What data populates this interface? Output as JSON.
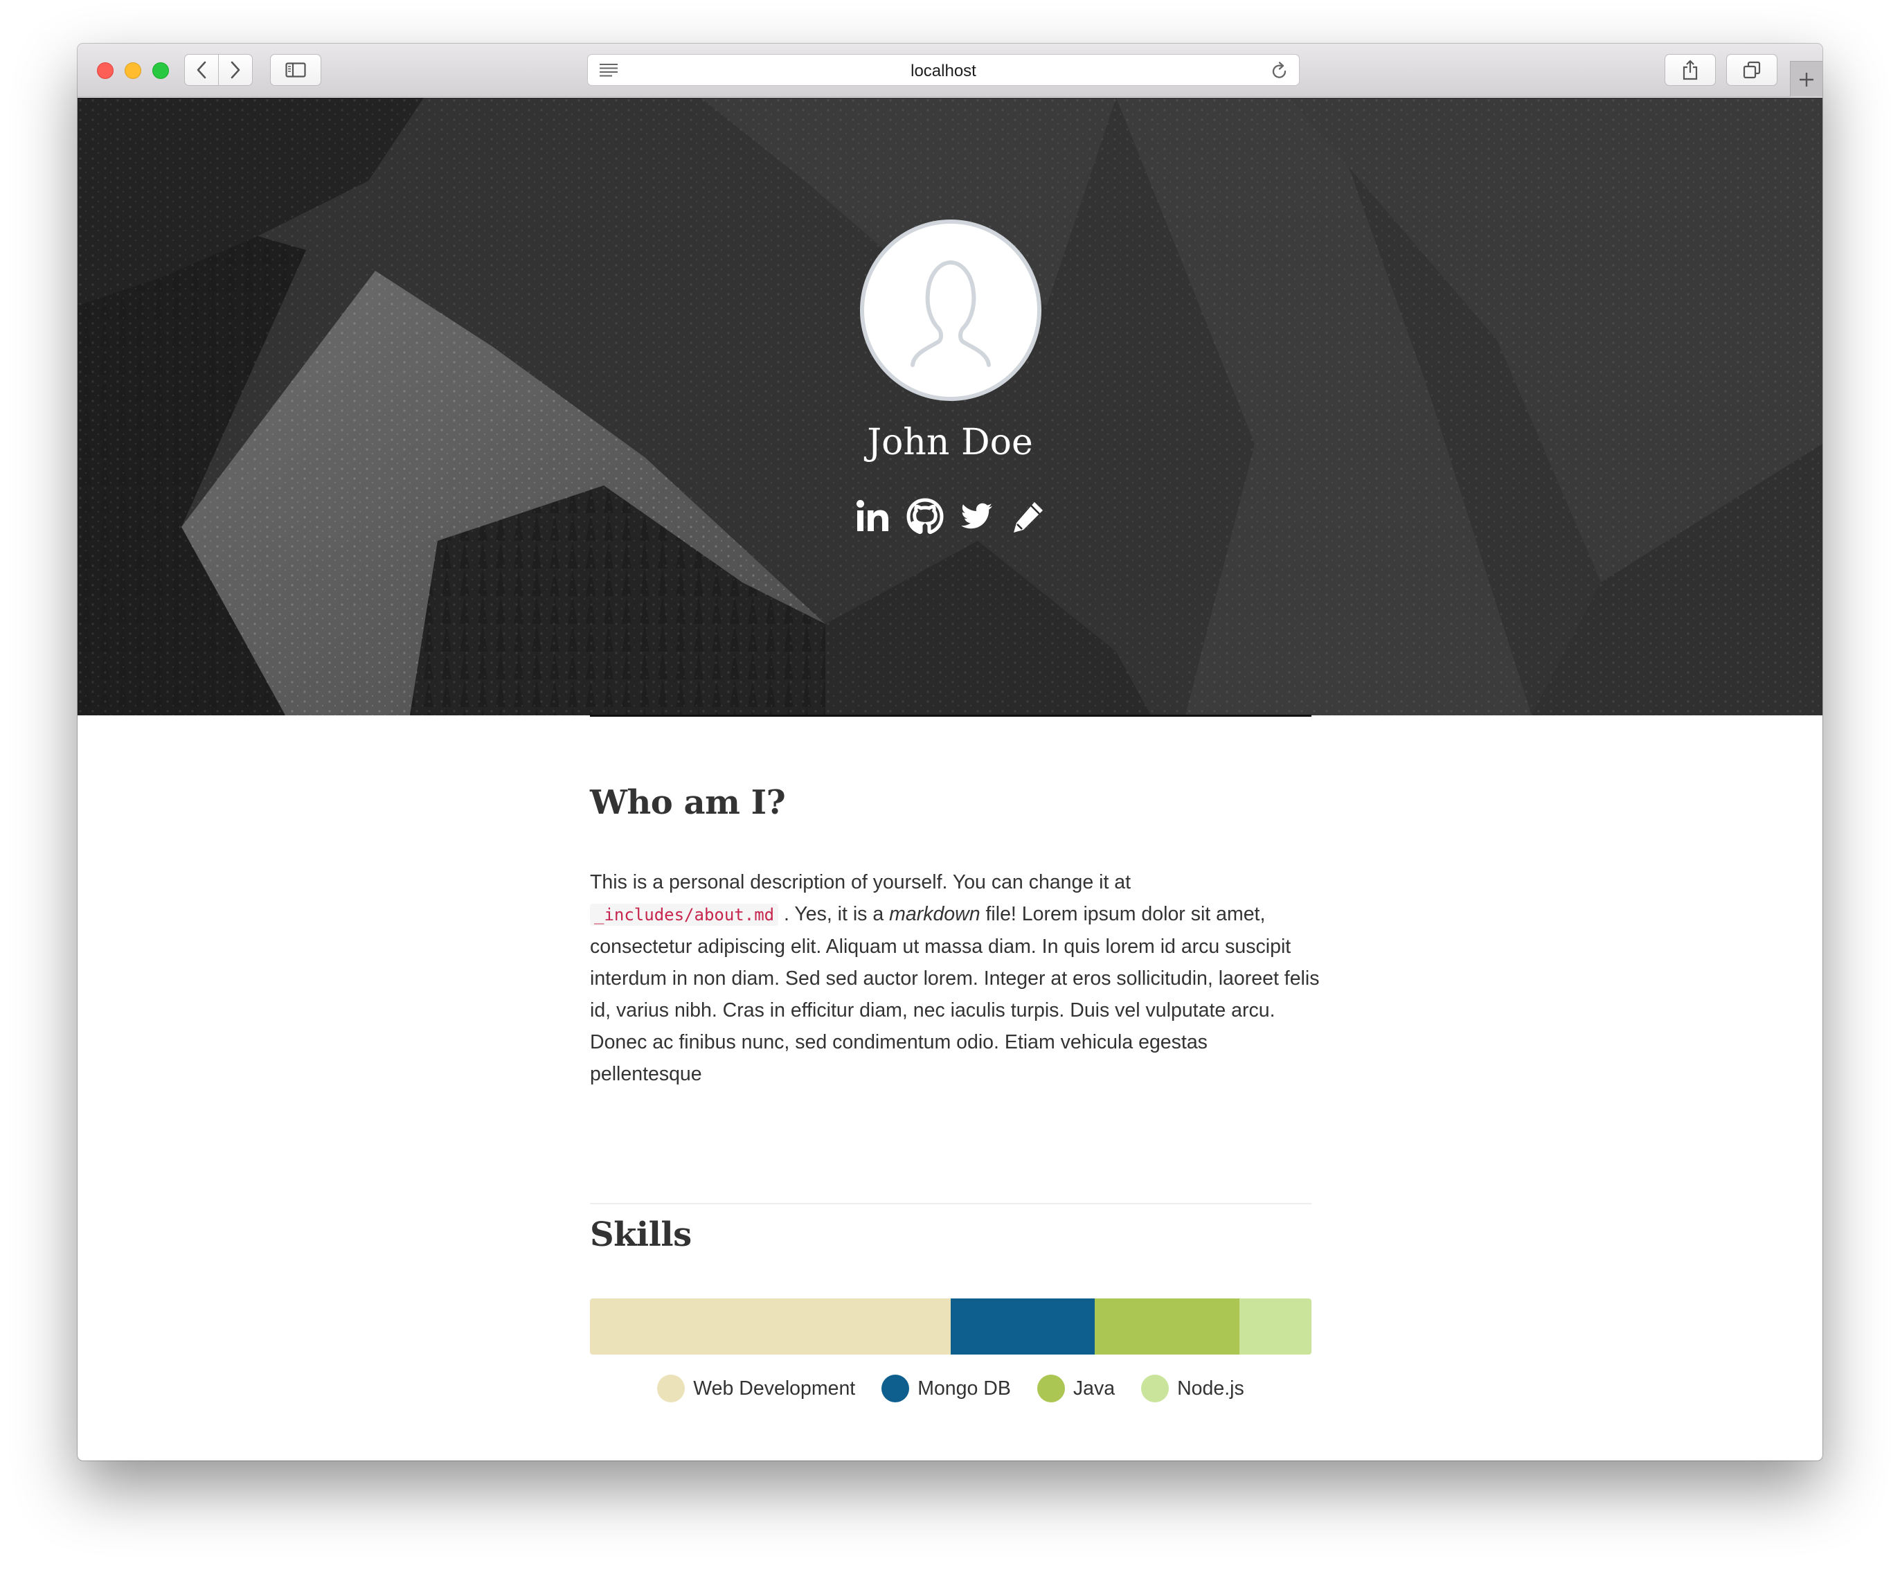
{
  "browser": {
    "url": "localhost"
  },
  "profile": {
    "name": "John Doe",
    "social": [
      {
        "icon": "linkedin-icon"
      },
      {
        "icon": "github-icon"
      },
      {
        "icon": "twitter-icon"
      },
      {
        "icon": "pencil-icon"
      }
    ]
  },
  "about": {
    "heading": "Who am I?",
    "text_1": "This is a personal description of yourself. You can change it at",
    "code": "_includes/about.md",
    "text_2": ". Yes, it is a",
    "emphasis": "markdown",
    "text_3": "file! Lorem ipsum dolor sit amet, consectetur adipiscing elit. Aliquam ut massa diam. In quis lorem id arcu suscipit interdum in non diam. Sed sed auctor lorem. Integer at eros sollicitudin, laoreet felis id, varius nibh. Cras in efficitur diam, nec iaculis turpis. Duis vel vulputate arcu. Donec ac finibus nunc, sed condimentum odio. Etiam vehicula egestas pellentesque"
  },
  "skills": {
    "heading": "Skills",
    "items": [
      {
        "name": "Web Development",
        "share": 0.5,
        "color": "#ebe2b9"
      },
      {
        "name": "Mongo DB",
        "share": 0.2,
        "color": "#0e5f8e"
      },
      {
        "name": "Java",
        "share": 0.2,
        "color": "#acc654"
      },
      {
        "name": "Node.js",
        "share": 0.1,
        "color": "#cbe49c"
      }
    ]
  }
}
